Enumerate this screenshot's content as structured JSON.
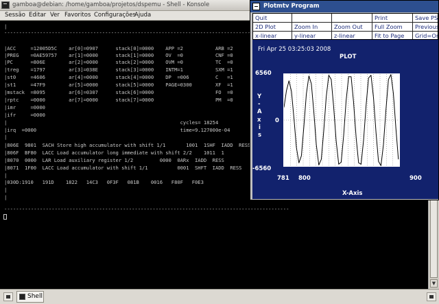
{
  "konsole": {
    "title": "gamboa@debian: /home/gamboa/projetos/dspemu - Shell - Konsole",
    "menu": [
      "Sessão",
      "Editar",
      "Ver",
      "Favoritos",
      "Configurações",
      "Ajuda"
    ],
    "tab_label": "Shell",
    "terminal_lines": [
      "|",
      "------------------------------------------------------------------------------------------------",
      "|ACC     =12005D5C    ar[0]=0907      stack[0]=0000    APP =2           ARB =2",
      "|PREG    =0AE59757    ar[1]=0000      stack[1]=0000    OV  =0           CNF =0",
      "|PC      =806E        ar[2]=0000      stack[2]=0000    OVM =0           TC  =0",
      "|treg    =1797        ar[3]=038E      stack[3]=0000    INTM=1           SXM =1",
      "|st0     =4606        ar[4]=0000      stack[4]=0000    DP  =006         C   =1",
      "|st1     =47F9        ar[5]=0000      stack[5]=0000    PAGE=0300        XF  =1",
      "|mstack  =8095        ar[6]=0307      stack[6]=0000                     FO  =0",
      "|rptc    =0000        ar[7]=0000      stack[7]=0000                     PM  =0",
      "|imr     =0000",
      "|ifr     =0000",
      "|                                                           cycles= 18254",
      "|irq  =0000                                                 time=9.127000e-04",
      "|",
      "|806E  9801  SACH Store high accumulator with shift 1/1       1001  1SHF  IADD  RESS",
      "|806F  BF80  LACC Load accumulator long immediate with shift 2/2    1011  1",
      "|8070  0000  LAR Load auxiliary register 1/2         0000  0ARx  IADD  RESS",
      "|8071  1F00  LACC Load accumulator with shift 1/1          0001  SHFT  IADD  RESS",
      "|",
      "|030D:1910   191D    1822   14C3   0F3F   081B    0016   F80F   F0E3",
      "|",
      "|",
      "------------------------------------------------------------------------------------------------"
    ]
  },
  "plot": {
    "title": "Plotmtv Program",
    "menu": [
      [
        "Quit",
        "",
        "",
        "Print",
        "Save PS"
      ],
      [
        "2D Plot",
        "Zoom In",
        "Zoom Out",
        "Full Zoom",
        "Previous"
      ],
      [
        "x-linear",
        "y-linear",
        "z-linear",
        "Fit to Page",
        "Grid=On"
      ]
    ],
    "date": "Fri Apr 25 03:25:03 2008",
    "plot_title": "PLOT",
    "xlabel": "X-Axis",
    "ylabel": [
      "Y",
      "-",
      "A",
      "x",
      "i",
      "s"
    ]
  },
  "colors": {
    "plot_bg": "#12226d",
    "plot_area": "#ffffff",
    "curve": "#000000",
    "grid": "#666666",
    "terminal_text": "#c8c8c8"
  },
  "chart_data": {
    "type": "line",
    "title": "PLOT",
    "xlabel": "X-Axis",
    "ylabel": "Y-Axis",
    "xlim": [
      781,
      920
    ],
    "ylim": [
      -6560,
      6560
    ],
    "xticks": [
      781,
      800,
      900
    ],
    "yticks": [
      6560,
      0,
      -6560
    ],
    "grid": true,
    "series": [
      {
        "x": [
          781,
          784,
          787,
          790,
          793,
          796,
          799,
          802,
          805,
          808,
          811,
          814,
          817,
          820,
          823,
          826,
          829,
          832,
          835,
          838,
          841,
          844,
          847,
          850,
          853,
          856,
          859,
          862,
          865,
          868,
          871,
          874,
          877,
          880,
          883,
          886,
          889,
          892,
          895,
          898,
          901,
          904,
          907,
          910,
          913,
          916,
          919
        ],
        "y": [
          1800,
          4200,
          5600,
          4100,
          300,
          -3900,
          -6100,
          -5100,
          -900,
          3700,
          6300,
          5200,
          1200,
          -3500,
          -6400,
          -5600,
          -1500,
          3300,
          6400,
          5800,
          1800,
          -3000,
          -6300,
          -6000,
          -2200,
          2800,
          6200,
          6200,
          2500,
          -2500,
          -6100,
          -6300,
          -2900,
          2100,
          6000,
          6400,
          3200,
          -1800,
          -5900,
          -6500,
          -3500,
          1500,
          5800,
          6500,
          3800,
          -1200,
          -5600
        ]
      }
    ]
  }
}
